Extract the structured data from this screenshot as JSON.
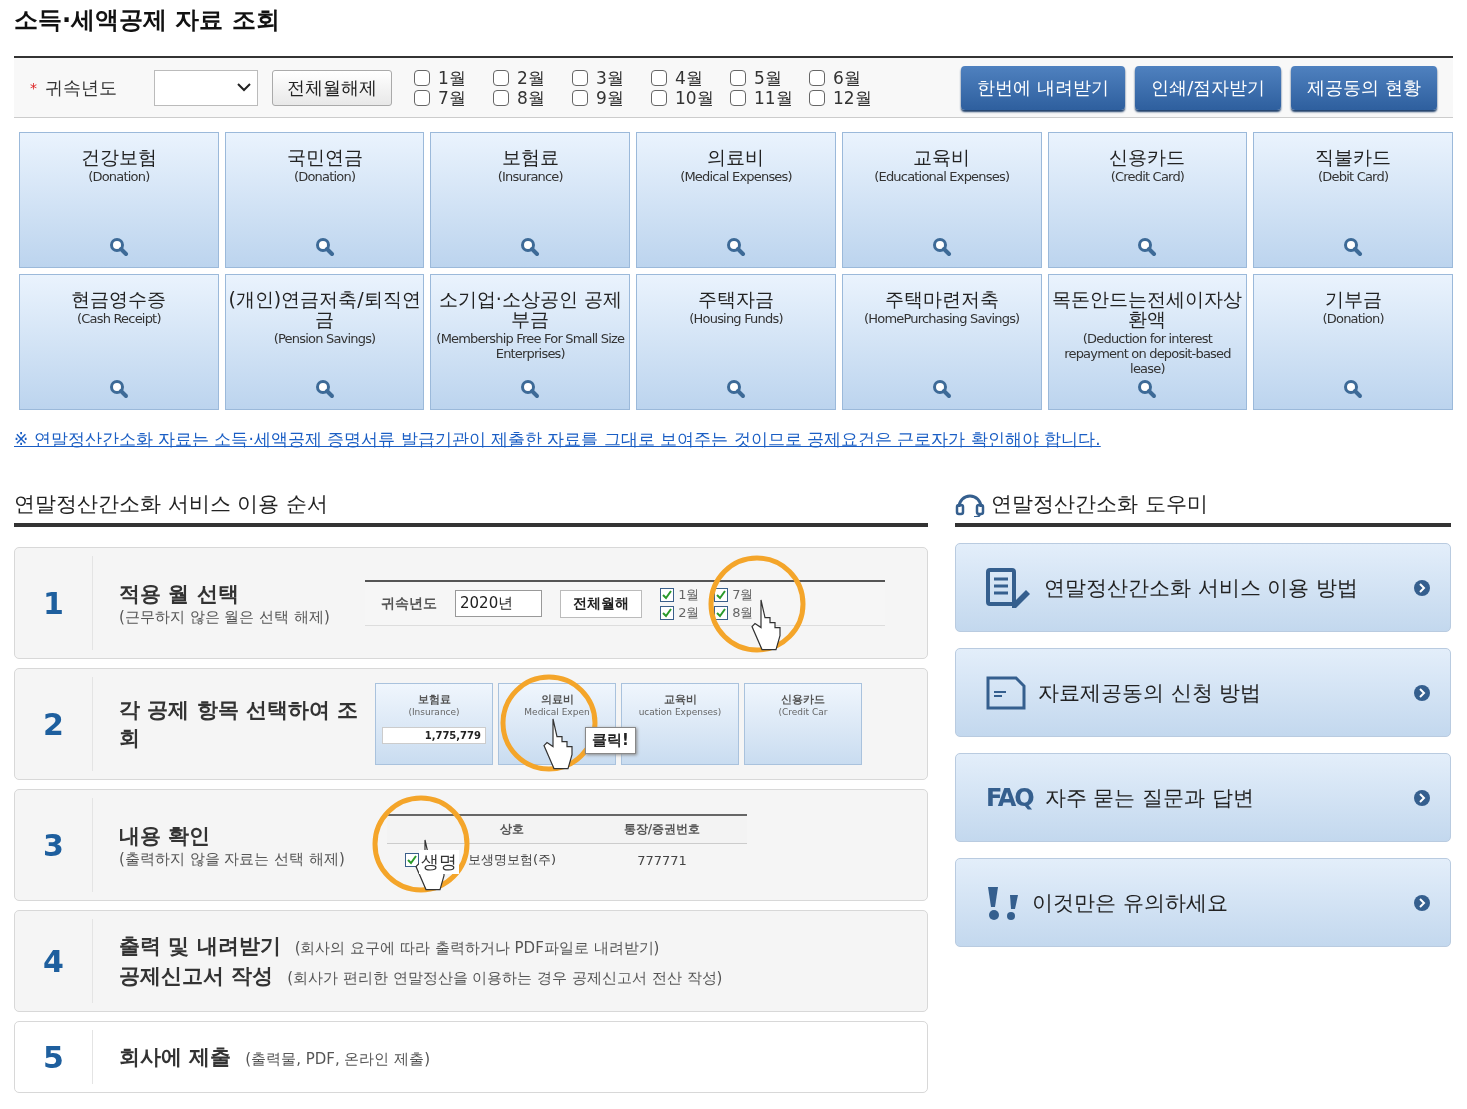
{
  "title": "소득·세액공제 자료 조회",
  "filter": {
    "required_mark": "*",
    "label": "귀속년도",
    "clear_button": "전체월해제",
    "months": [
      {
        "label": "1월",
        "checked": false
      },
      {
        "label": "2월",
        "checked": false
      },
      {
        "label": "3월",
        "checked": false
      },
      {
        "label": "4월",
        "checked": false
      },
      {
        "label": "5월",
        "checked": false
      },
      {
        "label": "6월",
        "checked": false
      },
      {
        "label": "7월",
        "checked": false
      },
      {
        "label": "8월",
        "checked": false
      },
      {
        "label": "9월",
        "checked": false
      },
      {
        "label": "10월",
        "checked": false
      },
      {
        "label": "11월",
        "checked": false
      },
      {
        "label": "12월",
        "checked": false
      }
    ],
    "buttons": [
      "한번에 내려받기",
      "인쇄/점자받기",
      "제공동의 현황"
    ]
  },
  "categories": [
    {
      "name": "건강보험",
      "english": "(Donation)"
    },
    {
      "name": "국민연금",
      "english": "(Donation)"
    },
    {
      "name": "보험료",
      "english": "(Insurance)"
    },
    {
      "name": "의료비",
      "english": "(Medical Expenses)"
    },
    {
      "name": "교육비",
      "english": "(Educational Expenses)"
    },
    {
      "name": "신용카드",
      "english": "(Credit Card)"
    },
    {
      "name": "직불카드",
      "english": "(Debit Card)"
    },
    {
      "name": "현금영수증",
      "english": "(Cash Receipt)"
    },
    {
      "name": "(개인)연금저축/퇴직연금",
      "english": "(Pension Savings)"
    },
    {
      "name": "소기업·소상공인 공제부금",
      "english": "(Membership Free For Small Size Enterprises)"
    },
    {
      "name": "주택자금",
      "english": "(Housing Funds)"
    },
    {
      "name": "주택마련저축",
      "english": "(HomePurchasing Savings)"
    },
    {
      "name": "목돈안드는전세이자상환액",
      "english": "(Deduction for interest repayment on deposit-based lease)"
    },
    {
      "name": "기부금",
      "english": "(Donation)"
    }
  ],
  "notice": "※ 연말정산간소화 자료는 소득·세액공제 증명서류 발급기관이 제출한 자료를 그대로 보여주는 것이므로 공제요건은 근로자가 확인해야 합니다.",
  "steps_section": {
    "title": "연말정산간소화 서비스 이용 순서",
    "steps": [
      {
        "number": "1",
        "kind": "stacked",
        "lines": [
          {
            "title": "적용 월 선택",
            "note": "(근무하지 않은 월은 선택 해제)"
          }
        ],
        "illustration": {
          "kind": "filter",
          "label": "귀속년도",
          "year": "2020년",
          "button": "전체월해",
          "months": [
            {
              "label": "1월",
              "checked": true
            },
            {
              "label": "7월",
              "checked": true
            },
            {
              "label": "2월",
              "checked": true
            },
            {
              "label": "8월",
              "checked": true
            }
          ]
        }
      },
      {
        "number": "2",
        "kind": "stacked",
        "lines": [
          {
            "title": "각 공제 항목 선택하여 조회"
          }
        ],
        "illustration": {
          "kind": "tiles",
          "callout": "클릭!",
          "tiles": [
            {
              "name": "보험료",
              "english": "(Insurance)",
              "amount": "1,775,779"
            },
            {
              "name": "의료비",
              "english": "Medical Expen"
            },
            {
              "name": "교육비",
              "english": "ucation Expenses)"
            },
            {
              "name": "신용카드",
              "english": "(Credit Car"
            }
          ]
        }
      },
      {
        "number": "3",
        "kind": "stacked",
        "lines": [
          {
            "title": "내용 확인",
            "note": "(출력하지 않을 자료는 선택 해제)"
          }
        ],
        "illustration": {
          "kind": "table",
          "columns": [
            "상호",
            "통장/증권번호"
          ],
          "magnified": "생명",
          "rows": [
            {
              "checked": true,
              "cells": [
                "보생명보험(주)",
                "777771"
              ]
            }
          ]
        }
      },
      {
        "number": "4",
        "kind": "inline",
        "lines": [
          {
            "title": "출력 및 내려받기",
            "note": "(회사의 요구에 따라 출력하거나 PDF파일로 내려받기)"
          },
          {
            "title": "공제신고서 작성",
            "note": "(회사가 편리한 연말정산을 이용하는 경우 공제신고서 전산 작성)"
          }
        ]
      },
      {
        "number": "5",
        "kind": "inline",
        "lines": [
          {
            "title": "회사에 제출",
            "note": "(출력물, PDF, 온라인 제출)"
          }
        ]
      }
    ]
  },
  "helper": {
    "title": "연말정산간소화 도우미",
    "links": [
      {
        "kind": "document",
        "label": "연말정산간소화 서비스 이용 방법"
      },
      {
        "kind": "form",
        "label": "자료제공동의 신청 방법"
      },
      {
        "kind": "faq",
        "badge": "FAQ",
        "label": "자주 묻는 질문과 답변"
      },
      {
        "kind": "warning",
        "label": "이것만은 유의하세요"
      }
    ]
  }
}
